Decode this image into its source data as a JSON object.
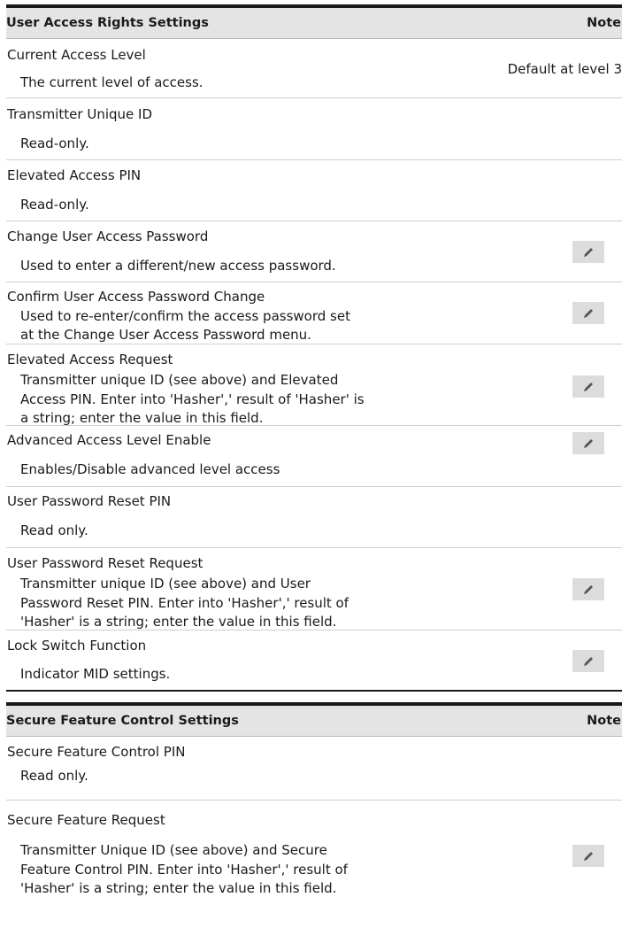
{
  "table1": {
    "header": {
      "title": "User Access Rights Settings",
      "note": "Note"
    },
    "rows": [
      {
        "title": "Current Access Level",
        "desc": [
          "The current level of access."
        ],
        "note": "Default at level 3",
        "edit": false
      },
      {
        "title": "Transmitter Unique ID",
        "desc": [
          "Read-only."
        ],
        "edit": false
      },
      {
        "title": "Elevated Access PIN",
        "desc": [
          "Read-only."
        ],
        "edit": false
      },
      {
        "title": "Change User Access Password",
        "desc": [
          "Used to enter a different/new access password."
        ],
        "edit": true
      },
      {
        "title": "Confirm User Access Password Change",
        "desc": [
          "Used to re-enter/confirm the access password set",
          "at the Change User Access Password menu."
        ],
        "edit": true
      },
      {
        "title": "Elevated Access Request",
        "desc": [
          "Transmitter unique ID (see above) and Elevated",
          "Access PIN. Enter into 'Hasher',' result of 'Hasher' is",
          "a string; enter the value in this field."
        ],
        "edit": true
      },
      {
        "title": "Advanced Access Level Enable",
        "desc": [
          "Enables/Disable advanced level access"
        ],
        "edit": true
      },
      {
        "title": "User Password Reset PIN",
        "desc": [
          "Read only."
        ],
        "edit": false
      },
      {
        "title": "User Password Reset Request",
        "desc": [
          "Transmitter unique ID (see above) and User",
          "Password Reset PIN. Enter into 'Hasher',' result of",
          "'Hasher' is a string; enter the value in this field."
        ],
        "edit": true
      },
      {
        "title": "Lock Switch Function",
        "desc": [
          "Indicator MID settings."
        ],
        "edit": true
      }
    ]
  },
  "table2": {
    "header": {
      "title": "Secure Feature Control Settings",
      "note": "Note"
    },
    "rows": [
      {
        "title": "Secure Feature Control PIN",
        "desc": [
          "Read only."
        ],
        "edit": false
      },
      {
        "title": "Secure Feature Request",
        "desc": [
          "Transmitter Unique ID (see above) and Secure",
          "Feature Control PIN. Enter into 'Hasher',' result of",
          "'Hasher' is a string; enter the value in this field."
        ],
        "edit": true
      }
    ]
  },
  "icons": {
    "edit": "pencil-icon"
  },
  "colors": {
    "header_bg": "#e4e4e4",
    "rule": "#1a1a1a",
    "edit_button_bg": "#dcdcdc"
  }
}
